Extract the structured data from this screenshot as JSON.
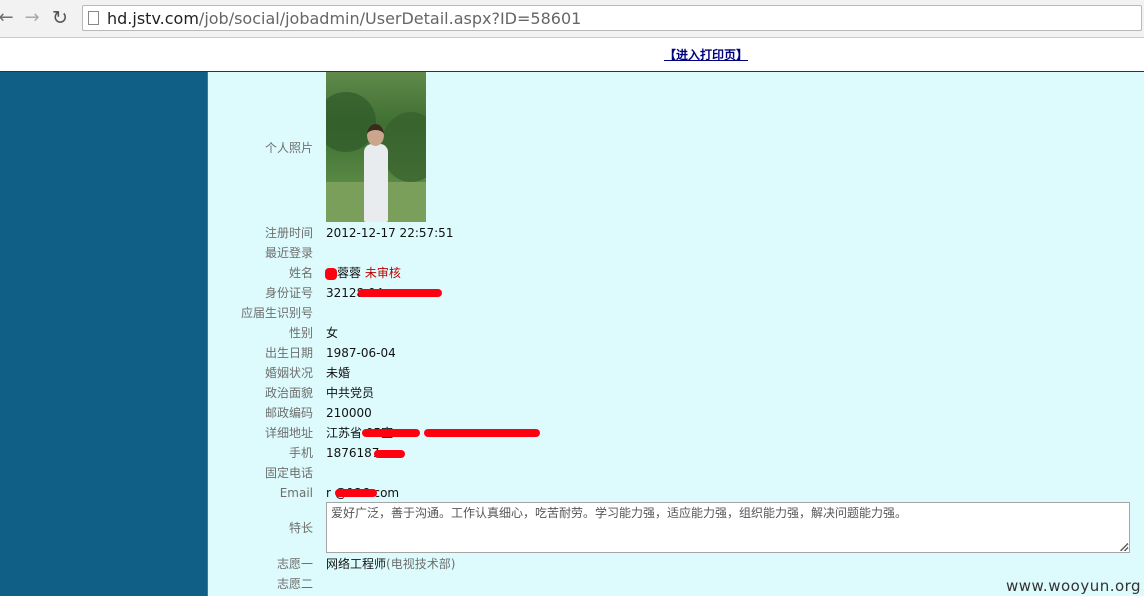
{
  "browser": {
    "url_host": "hd.jstv.com",
    "url_path": "/job/social/jobadmin/UserDetail.aspx?ID=58601"
  },
  "page": {
    "print_link": "【进入打印页】"
  },
  "fields": {
    "photo_label": "个人照片",
    "reg_time_label": "注册时间",
    "reg_time_value": "2012-12-17 22:57:51",
    "last_login_label": "最近登录",
    "name_label": "姓名",
    "name_value": "蓉蓉",
    "name_status": "未审核",
    "id_label": "身份证号",
    "id_value": "32128          04",
    "student_id_label": "应届生识别号",
    "gender_label": "性别",
    "gender_value": "女",
    "birth_label": "出生日期",
    "birth_value": "1987-06-04",
    "marital_label": "婚姻状况",
    "marital_value": "未婚",
    "political_label": "政治面貌",
    "political_value": "中共党员",
    "postcode_label": "邮政编码",
    "postcode_value": "210000",
    "address_label": "详细地址",
    "address_value": "江苏省                           05室",
    "mobile_label": "手机",
    "mobile_value": "1876187",
    "phone_label": "固定电话",
    "email_label": "Email",
    "email_value": "r         @126.com",
    "strength_label": "特长",
    "strength_value": "爱好广泛，善于沟通。工作认真细心，吃苦耐劳。学习能力强，适应能力强，组织能力强，解决问题能力强。",
    "wish1_label": "志愿一",
    "wish1_value": "网络工程师",
    "wish1_dept": "(电视技术部)",
    "wish2_label": "志愿二"
  },
  "watermark": "www.wooyun.org",
  "colors": {
    "content_bg": "#ddfbfd",
    "left_panel": "#0f5f86",
    "redaction": "#ff0010",
    "status": "#c00000",
    "link": "#000080"
  },
  "icons": [
    "back-arrow-icon",
    "forward-arrow-icon",
    "reload-icon",
    "page-icon"
  ]
}
